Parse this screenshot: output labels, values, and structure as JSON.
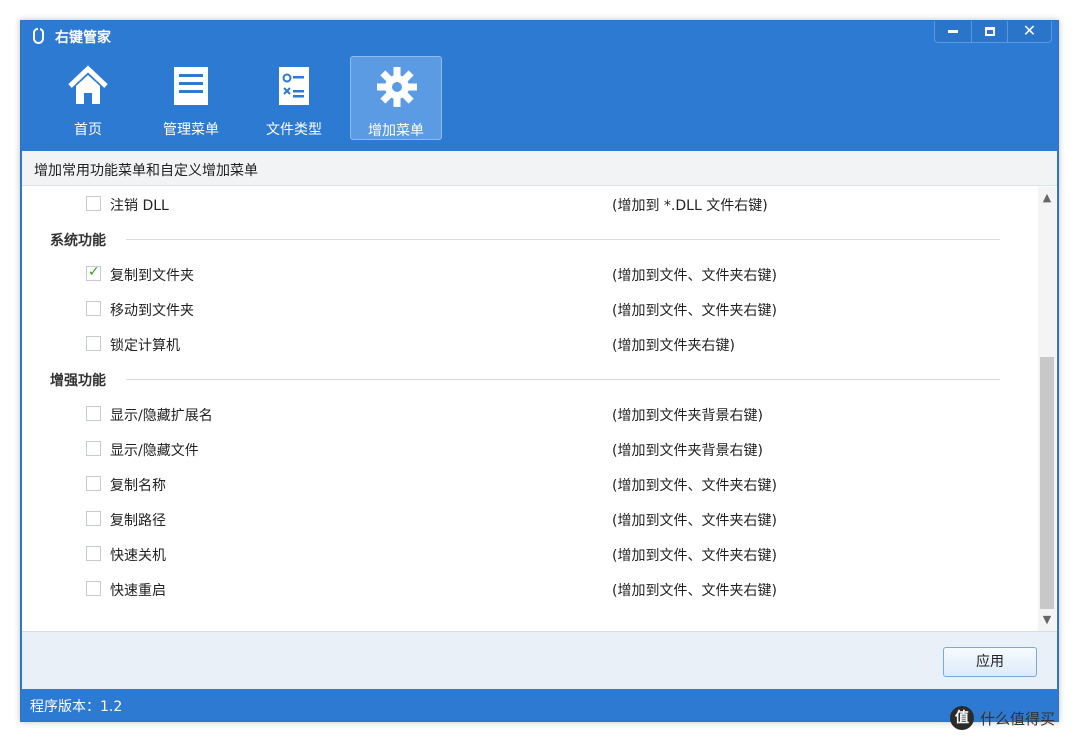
{
  "window": {
    "title": "右键管家"
  },
  "toolbar": {
    "items": [
      {
        "label": "首页",
        "icon": "home-icon",
        "active": false
      },
      {
        "label": "管理菜单",
        "icon": "list-icon",
        "active": false
      },
      {
        "label": "文件类型",
        "icon": "file-type-icon",
        "active": false
      },
      {
        "label": "增加菜单",
        "icon": "gear-icon",
        "active": true
      }
    ]
  },
  "content": {
    "subtitle": "增加常用功能菜单和自定义增加菜单",
    "rows": [
      {
        "kind": "item",
        "label": "注销 DLL",
        "desc": "(增加到 *.DLL 文件右键)",
        "checked": false
      },
      {
        "kind": "section",
        "label": "系统功能"
      },
      {
        "kind": "item",
        "label": "复制到文件夹",
        "desc": "(增加到文件、文件夹右键)",
        "checked": true
      },
      {
        "kind": "item",
        "label": "移动到文件夹",
        "desc": "(增加到文件、文件夹右键)",
        "checked": false
      },
      {
        "kind": "item",
        "label": "锁定计算机",
        "desc": "(增加到文件夹右键)",
        "checked": false
      },
      {
        "kind": "section",
        "label": "增强功能"
      },
      {
        "kind": "item",
        "label": "显示/隐藏扩展名",
        "desc": "(增加到文件夹背景右键)",
        "checked": false
      },
      {
        "kind": "item",
        "label": "显示/隐藏文件",
        "desc": "(增加到文件夹背景右键)",
        "checked": false
      },
      {
        "kind": "item",
        "label": "复制名称",
        "desc": "(增加到文件、文件夹右键)",
        "checked": false
      },
      {
        "kind": "item",
        "label": "复制路径",
        "desc": "(增加到文件、文件夹右键)",
        "checked": false
      },
      {
        "kind": "item",
        "label": "快速关机",
        "desc": "(增加到文件、文件夹右键)",
        "checked": false
      },
      {
        "kind": "item",
        "label": "快速重启",
        "desc": "(增加到文件、文件夹右键)",
        "checked": false
      }
    ]
  },
  "footer": {
    "apply_label": "应用"
  },
  "status": {
    "version_text": "程序版本：1.2"
  },
  "watermark": {
    "logo_char": "值",
    "text": "什么值得买"
  },
  "colors": {
    "accent": "#2d7ad2",
    "active_tab": "#5b9be4",
    "check": "#3d9b21"
  }
}
